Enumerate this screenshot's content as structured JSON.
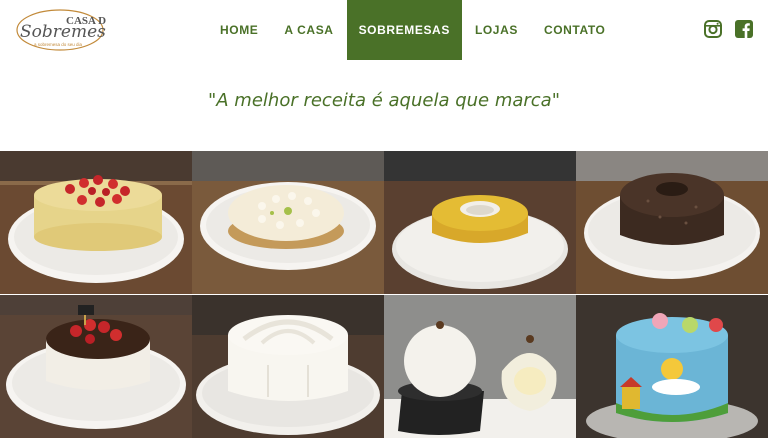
{
  "brand": {
    "logo_line1": "CASA DA",
    "logo_line2": "Sobremesa",
    "logo_tagline": "a sobremesa do seu dia",
    "colors": {
      "primary": "#4a7128",
      "accent": "#c28a3a"
    }
  },
  "nav": {
    "items": [
      {
        "label": "HOME",
        "active": false
      },
      {
        "label": "A CASA",
        "active": false
      },
      {
        "label": "SOBREMESAS",
        "active": true
      },
      {
        "label": "LOJAS",
        "active": false
      },
      {
        "label": "CONTATO",
        "active": false
      }
    ]
  },
  "social": {
    "icons": [
      "instagram-icon",
      "facebook-icon"
    ]
  },
  "hero": {
    "tagline": "\"A melhor receita é aquela que marca\""
  },
  "gallery": {
    "items": [
      {
        "name": "strawberry-coconut-cake"
      },
      {
        "name": "lime-meringue-pie"
      },
      {
        "name": "passion-fruit-pudding"
      },
      {
        "name": "chocolate-sprinkle-ring-cake"
      },
      {
        "name": "strawberry-chocolate-cheesecake"
      },
      {
        "name": "white-cream-cake"
      },
      {
        "name": "coconut-bonbon"
      },
      {
        "name": "peppa-pig-fondant-cake"
      }
    ]
  }
}
